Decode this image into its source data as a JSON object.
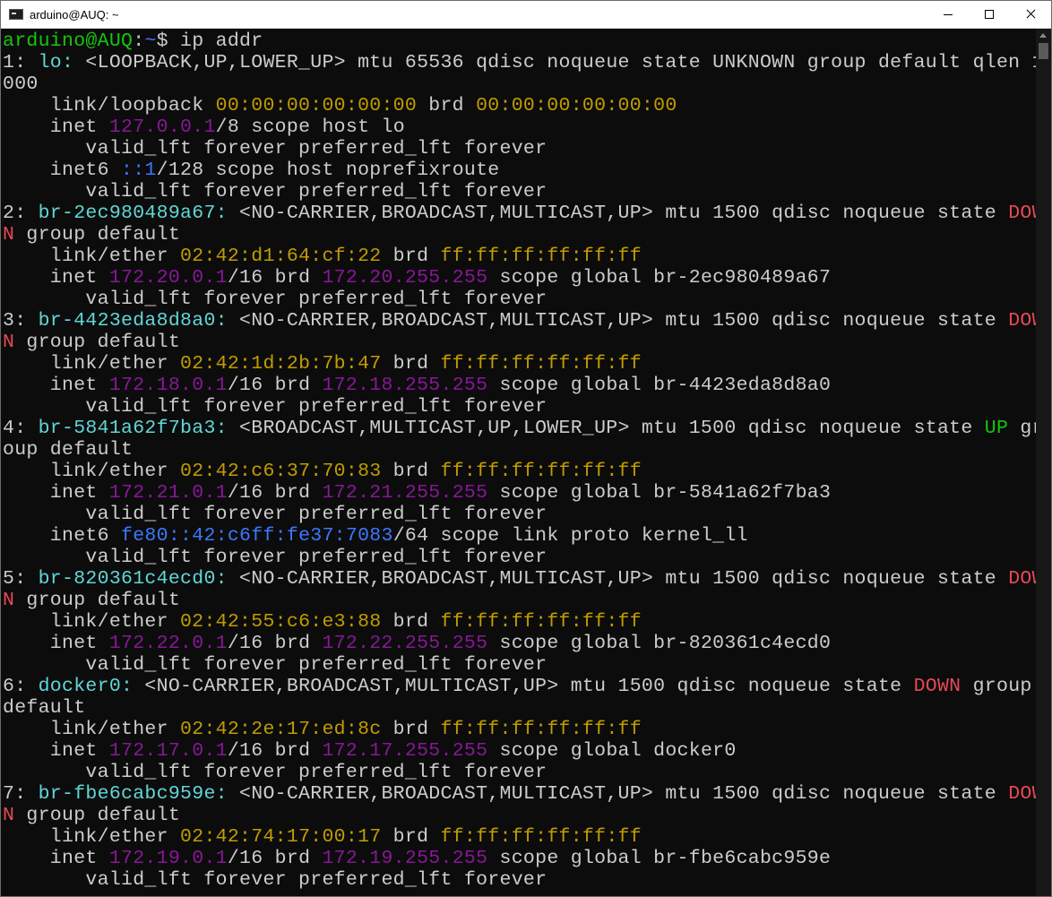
{
  "window": {
    "title": "arduino@AUQ: ~"
  },
  "colors": {
    "prompt": "#16c60c",
    "interface": "#3b78ff",
    "address": "#881798",
    "mac": "#c19c00",
    "down": "#e74856",
    "up": "#16c60c"
  },
  "terminal": {
    "lines": [
      [
        {
          "t": "arduino@AUQ",
          "c": "c-green"
        },
        {
          "t": ":",
          "c": "c-white"
        },
        {
          "t": "~",
          "c": "c-blue"
        },
        {
          "t": "$ ip addr",
          "c": "c-white"
        }
      ],
      [
        {
          "t": "1: ",
          "c": "c-white"
        },
        {
          "t": "lo:",
          "c": "c-cyan"
        },
        {
          "t": " <LOOPBACK,UP,LOWER_UP> mtu 65536 qdisc noqueue state UNKNOWN group default qlen 1",
          "c": "c-white"
        }
      ],
      [
        {
          "t": "000",
          "c": "c-white"
        }
      ],
      [
        {
          "t": "    link/loopback ",
          "c": "c-white"
        },
        {
          "t": "00:00:00:00:00:00",
          "c": "c-yellow"
        },
        {
          "t": " brd ",
          "c": "c-white"
        },
        {
          "t": "00:00:00:00:00:00",
          "c": "c-yellow"
        }
      ],
      [
        {
          "t": "    inet ",
          "c": "c-white"
        },
        {
          "t": "127.0.0.1",
          "c": "c-magenta"
        },
        {
          "t": "/8 scope host lo",
          "c": "c-white"
        }
      ],
      [
        {
          "t": "       valid_lft forever preferred_lft forever",
          "c": "c-white"
        }
      ],
      [
        {
          "t": "    inet6 ",
          "c": "c-white"
        },
        {
          "t": "::1",
          "c": "c-blue"
        },
        {
          "t": "/128 scope host noprefixroute",
          "c": "c-white"
        }
      ],
      [
        {
          "t": "       valid_lft forever preferred_lft forever",
          "c": "c-white"
        }
      ],
      [
        {
          "t": "2: ",
          "c": "c-white"
        },
        {
          "t": "br-2ec980489a67:",
          "c": "c-cyan"
        },
        {
          "t": " <NO-CARRIER,BROADCAST,MULTICAST,UP> mtu 1500 qdisc noqueue state ",
          "c": "c-white"
        },
        {
          "t": "DOW",
          "c": "c-red"
        }
      ],
      [
        {
          "t": "N",
          "c": "c-red"
        },
        {
          "t": " group default",
          "c": "c-white"
        }
      ],
      [
        {
          "t": "    link/ether ",
          "c": "c-white"
        },
        {
          "t": "02:42:d1:64:cf:22",
          "c": "c-yellow"
        },
        {
          "t": " brd ",
          "c": "c-white"
        },
        {
          "t": "ff:ff:ff:ff:ff:ff",
          "c": "c-yellow"
        }
      ],
      [
        {
          "t": "    inet ",
          "c": "c-white"
        },
        {
          "t": "172.20.0.1",
          "c": "c-magenta"
        },
        {
          "t": "/16 brd ",
          "c": "c-white"
        },
        {
          "t": "172.20.255.255",
          "c": "c-magenta"
        },
        {
          "t": " scope global br-2ec980489a67",
          "c": "c-white"
        }
      ],
      [
        {
          "t": "       valid_lft forever preferred_lft forever",
          "c": "c-white"
        }
      ],
      [
        {
          "t": "3: ",
          "c": "c-white"
        },
        {
          "t": "br-4423eda8d8a0:",
          "c": "c-cyan"
        },
        {
          "t": " <NO-CARRIER,BROADCAST,MULTICAST,UP> mtu 1500 qdisc noqueue state ",
          "c": "c-white"
        },
        {
          "t": "DOW",
          "c": "c-red"
        }
      ],
      [
        {
          "t": "N",
          "c": "c-red"
        },
        {
          "t": " group default",
          "c": "c-white"
        }
      ],
      [
        {
          "t": "    link/ether ",
          "c": "c-white"
        },
        {
          "t": "02:42:1d:2b:7b:47",
          "c": "c-yellow"
        },
        {
          "t": " brd ",
          "c": "c-white"
        },
        {
          "t": "ff:ff:ff:ff:ff:ff",
          "c": "c-yellow"
        }
      ],
      [
        {
          "t": "    inet ",
          "c": "c-white"
        },
        {
          "t": "172.18.0.1",
          "c": "c-magenta"
        },
        {
          "t": "/16 brd ",
          "c": "c-white"
        },
        {
          "t": "172.18.255.255",
          "c": "c-magenta"
        },
        {
          "t": " scope global br-4423eda8d8a0",
          "c": "c-white"
        }
      ],
      [
        {
          "t": "       valid_lft forever preferred_lft forever",
          "c": "c-white"
        }
      ],
      [
        {
          "t": "4: ",
          "c": "c-white"
        },
        {
          "t": "br-5841a62f7ba3:",
          "c": "c-cyan"
        },
        {
          "t": " <BROADCAST,MULTICAST,UP,LOWER_UP> mtu 1500 qdisc noqueue state ",
          "c": "c-white"
        },
        {
          "t": "UP",
          "c": "c-green"
        },
        {
          "t": " gr",
          "c": "c-white"
        }
      ],
      [
        {
          "t": "oup default",
          "c": "c-white"
        }
      ],
      [
        {
          "t": "    link/ether ",
          "c": "c-white"
        },
        {
          "t": "02:42:c6:37:70:83",
          "c": "c-yellow"
        },
        {
          "t": " brd ",
          "c": "c-white"
        },
        {
          "t": "ff:ff:ff:ff:ff:ff",
          "c": "c-yellow"
        }
      ],
      [
        {
          "t": "    inet ",
          "c": "c-white"
        },
        {
          "t": "172.21.0.1",
          "c": "c-magenta"
        },
        {
          "t": "/16 brd ",
          "c": "c-white"
        },
        {
          "t": "172.21.255.255",
          "c": "c-magenta"
        },
        {
          "t": " scope global br-5841a62f7ba3",
          "c": "c-white"
        }
      ],
      [
        {
          "t": "       valid_lft forever preferred_lft forever",
          "c": "c-white"
        }
      ],
      [
        {
          "t": "    inet6 ",
          "c": "c-white"
        },
        {
          "t": "fe80::42:c6ff:fe37:7083",
          "c": "c-blue"
        },
        {
          "t": "/64 scope link proto kernel_ll",
          "c": "c-white"
        }
      ],
      [
        {
          "t": "       valid_lft forever preferred_lft forever",
          "c": "c-white"
        }
      ],
      [
        {
          "t": "5: ",
          "c": "c-white"
        },
        {
          "t": "br-820361c4ecd0:",
          "c": "c-cyan"
        },
        {
          "t": " <NO-CARRIER,BROADCAST,MULTICAST,UP> mtu 1500 qdisc noqueue state ",
          "c": "c-white"
        },
        {
          "t": "DOW",
          "c": "c-red"
        }
      ],
      [
        {
          "t": "N",
          "c": "c-red"
        },
        {
          "t": " group default",
          "c": "c-white"
        }
      ],
      [
        {
          "t": "    link/ether ",
          "c": "c-white"
        },
        {
          "t": "02:42:55:c6:e3:88",
          "c": "c-yellow"
        },
        {
          "t": " brd ",
          "c": "c-white"
        },
        {
          "t": "ff:ff:ff:ff:ff:ff",
          "c": "c-yellow"
        }
      ],
      [
        {
          "t": "    inet ",
          "c": "c-white"
        },
        {
          "t": "172.22.0.1",
          "c": "c-magenta"
        },
        {
          "t": "/16 brd ",
          "c": "c-white"
        },
        {
          "t": "172.22.255.255",
          "c": "c-magenta"
        },
        {
          "t": " scope global br-820361c4ecd0",
          "c": "c-white"
        }
      ],
      [
        {
          "t": "       valid_lft forever preferred_lft forever",
          "c": "c-white"
        }
      ],
      [
        {
          "t": "6: ",
          "c": "c-white"
        },
        {
          "t": "docker0:",
          "c": "c-cyan"
        },
        {
          "t": " <NO-CARRIER,BROADCAST,MULTICAST,UP> mtu 1500 qdisc noqueue state ",
          "c": "c-white"
        },
        {
          "t": "DOWN",
          "c": "c-red"
        },
        {
          "t": " group",
          "c": "c-white"
        }
      ],
      [
        {
          "t": "default",
          "c": "c-white"
        }
      ],
      [
        {
          "t": "    link/ether ",
          "c": "c-white"
        },
        {
          "t": "02:42:2e:17:ed:8c",
          "c": "c-yellow"
        },
        {
          "t": " brd ",
          "c": "c-white"
        },
        {
          "t": "ff:ff:ff:ff:ff:ff",
          "c": "c-yellow"
        }
      ],
      [
        {
          "t": "    inet ",
          "c": "c-white"
        },
        {
          "t": "172.17.0.1",
          "c": "c-magenta"
        },
        {
          "t": "/16 brd ",
          "c": "c-white"
        },
        {
          "t": "172.17.255.255",
          "c": "c-magenta"
        },
        {
          "t": " scope global docker0",
          "c": "c-white"
        }
      ],
      [
        {
          "t": "       valid_lft forever preferred_lft forever",
          "c": "c-white"
        }
      ],
      [
        {
          "t": "7: ",
          "c": "c-white"
        },
        {
          "t": "br-fbe6cabc959e:",
          "c": "c-cyan"
        },
        {
          "t": " <NO-CARRIER,BROADCAST,MULTICAST,UP> mtu 1500 qdisc noqueue state ",
          "c": "c-white"
        },
        {
          "t": "DOW",
          "c": "c-red"
        }
      ],
      [
        {
          "t": "N",
          "c": "c-red"
        },
        {
          "t": " group default",
          "c": "c-white"
        }
      ],
      [
        {
          "t": "    link/ether ",
          "c": "c-white"
        },
        {
          "t": "02:42:74:17:00:17",
          "c": "c-yellow"
        },
        {
          "t": " brd ",
          "c": "c-white"
        },
        {
          "t": "ff:ff:ff:ff:ff:ff",
          "c": "c-yellow"
        }
      ],
      [
        {
          "t": "    inet ",
          "c": "c-white"
        },
        {
          "t": "172.19.0.1",
          "c": "c-magenta"
        },
        {
          "t": "/16 brd ",
          "c": "c-white"
        },
        {
          "t": "172.19.255.255",
          "c": "c-magenta"
        },
        {
          "t": " scope global br-fbe6cabc959e",
          "c": "c-white"
        }
      ],
      [
        {
          "t": "       valid_lft forever preferred_lft forever",
          "c": "c-white"
        }
      ]
    ]
  }
}
